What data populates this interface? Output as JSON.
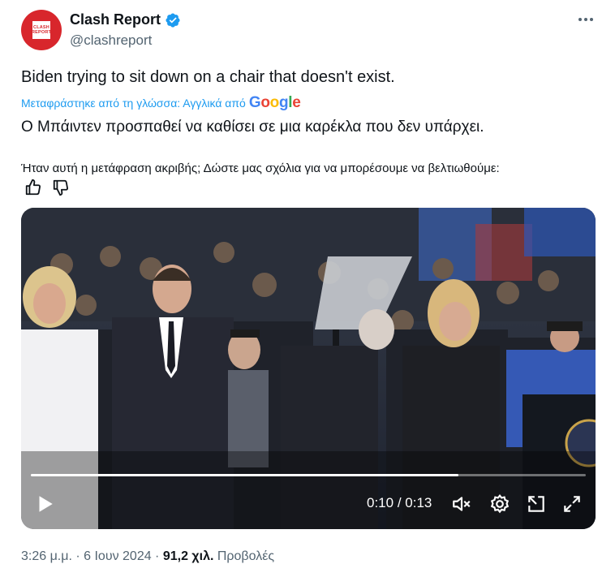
{
  "author": {
    "display_name": "Clash Report",
    "handle": "@clashreport",
    "avatar_text_line1": "CLASH",
    "avatar_text_line2": "REPORT",
    "verified_color": "#1d9bf0"
  },
  "tweet": {
    "text": "Biden trying to sit down on a chair that doesn't exist.",
    "translated_label": "Μεταφράστηκε από τη γλώσσα: Αγγλικά από",
    "translated_provider": "Google",
    "translation": "Ο Μπάιντεν προσπαθεί να καθίσει σε μια καρέκλα που δεν υπάρχει.",
    "feedback_prompt": "Ήταν αυτή η μετάφραση ακριβής; Δώστε μας σχόλια για να μπορέσουμε να βελτιωθούμε:"
  },
  "video": {
    "current_time": "0:10",
    "separator": " / ",
    "duration": "0:13",
    "progress": 0.77,
    "icons": [
      "play-icon",
      "mute-icon",
      "settings-icon",
      "popout-icon",
      "fullscreen-icon"
    ]
  },
  "footer": {
    "timestamp": "3:26 μ.μ. · 6 Ιουν 2024 · ",
    "views_count": "91,2 χιλ.",
    "views_label": " Προβολές"
  },
  "colors": {
    "accent": "#1d9bf0",
    "brand_red": "#d8262c",
    "muted_text": "#536471"
  }
}
